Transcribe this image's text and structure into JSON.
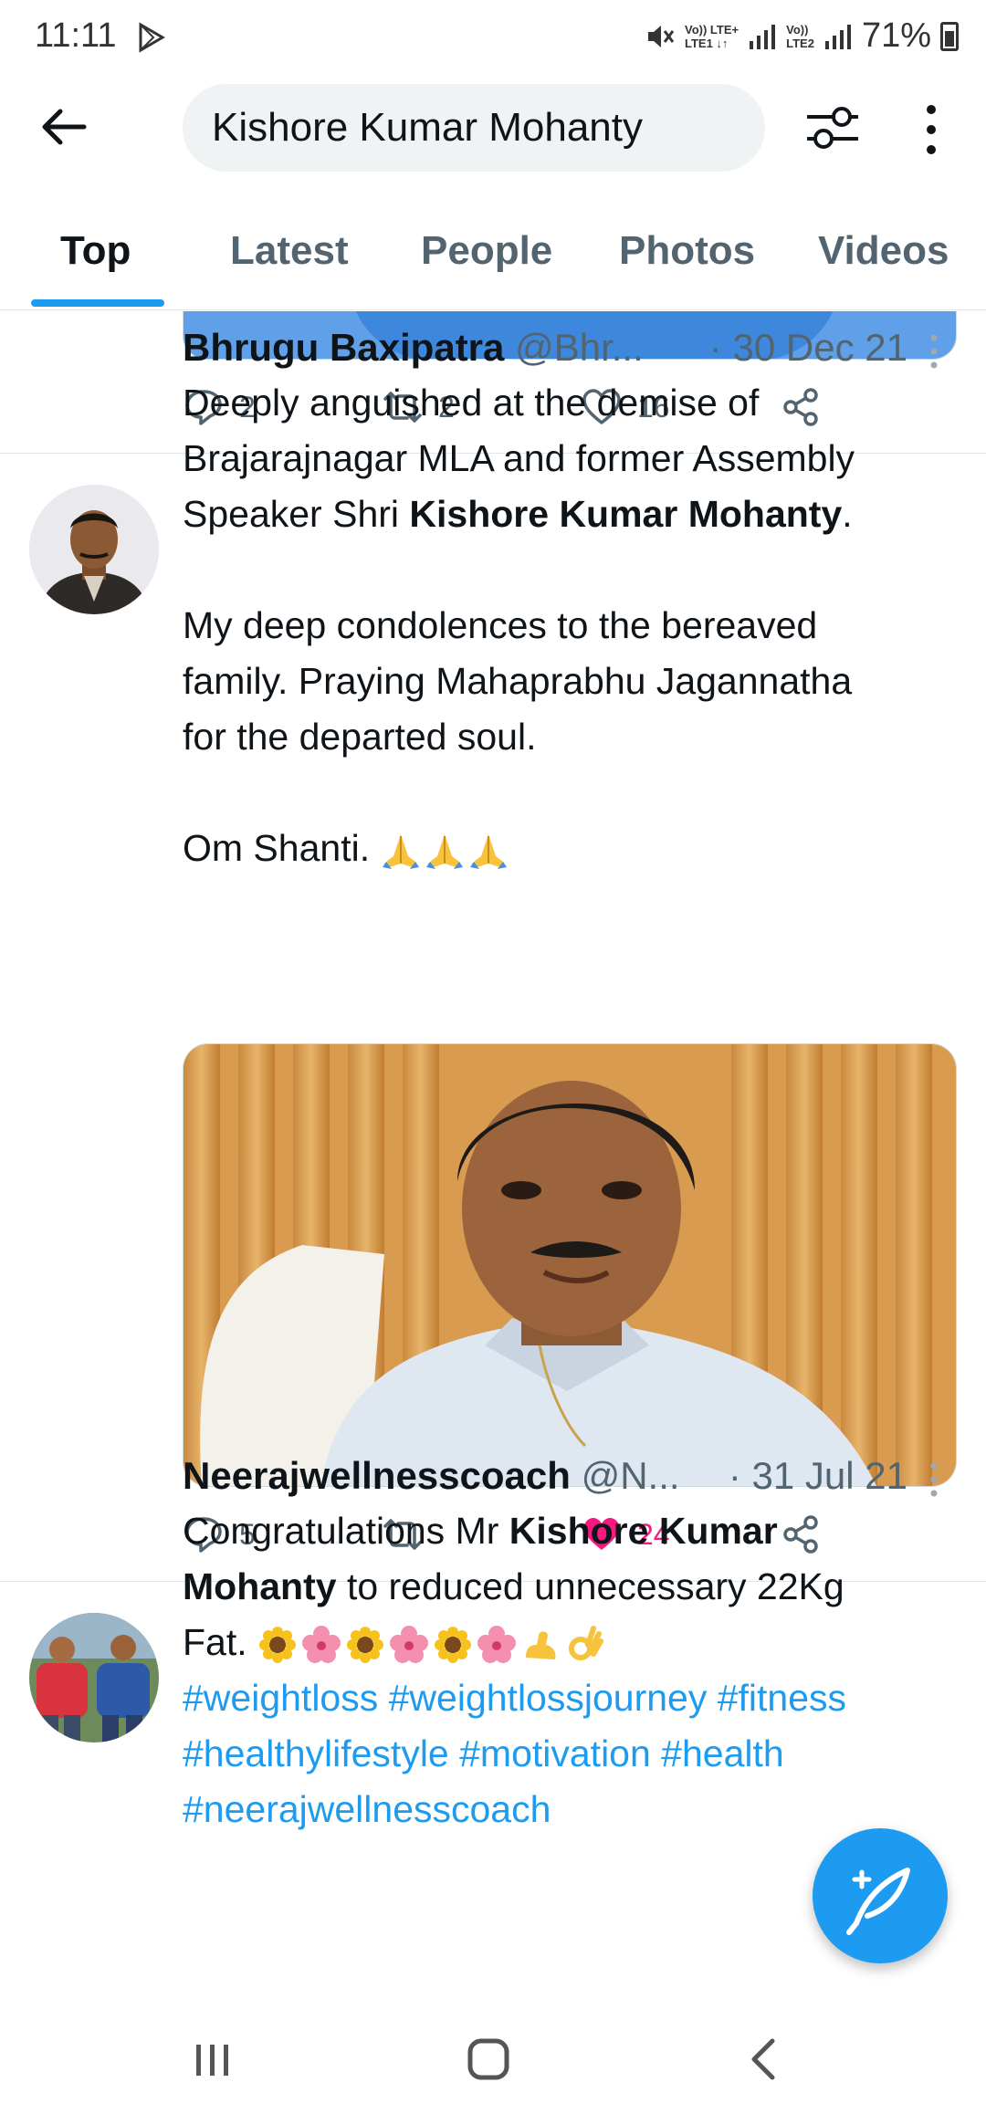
{
  "status_bar": {
    "time": "11:11",
    "net1_top": "Vo)) LTE+",
    "net1_bottom": "LTE1 ↓↑",
    "net2_top": "Vo))",
    "net2_bottom": "LTE2",
    "battery": "71%"
  },
  "search": {
    "query": "Kishore Kumar Mohanty",
    "back_icon": "back-arrow-icon",
    "filter_icon": "filter-sliders-icon",
    "more_icon": "more-vertical-icon"
  },
  "tabs": [
    {
      "label": "Top",
      "active": true
    },
    {
      "label": "Latest",
      "active": false
    },
    {
      "label": "People",
      "active": false
    },
    {
      "label": "Photos",
      "active": false
    },
    {
      "label": "Videos",
      "active": false
    }
  ],
  "previous_tweet": {
    "replies": "2",
    "retweets": "2",
    "likes": "16"
  },
  "tweets": [
    {
      "name": "Bhrugu Baxipatra",
      "handle": "@Bhr...",
      "date": "· 30 Dec 21",
      "text_line1": "Deeply anguished at the demise of",
      "text_line2": "Brajarajnagar MLA and former Assembly",
      "text_line3_pre": "Speaker Shri ",
      "text_line3_bold": "Kishore Kumar Mohanty",
      "text_line3_post": ".",
      "text_para2_line1": "My deep condolences to the bereaved",
      "text_para2_line2": "family. Praying Mahaprabhu Jagannatha",
      "text_para2_line3": "for the departed soul.",
      "text_para3": "Om Shanti.",
      "replies": "5",
      "retweets": "",
      "likes": "24",
      "liked": true
    },
    {
      "name": "Neerajwellnesscoach",
      "handle": "@N...",
      "date": "· 31 Jul 21",
      "line1_pre": "Congratulations Mr ",
      "line1_bold": "Kishore Kumar",
      "line2_bold": "Mohanty",
      "line2_post": " to reduced unnecessary 22Kg",
      "line3": "Fat.",
      "hashtags_line1": "#weightloss #weightlossjourney #fitness",
      "hashtags_line2": "#healthylifestyle #motivation #health",
      "hashtags_line3": "#neerajwellnesscoach"
    }
  ],
  "colors": {
    "accent": "#1d9bf0",
    "like": "#f91880",
    "secondary_text": "#536471"
  },
  "fab_icon": "compose-feather-icon",
  "nav": [
    "recents-icon",
    "home-icon",
    "back-icon"
  ]
}
